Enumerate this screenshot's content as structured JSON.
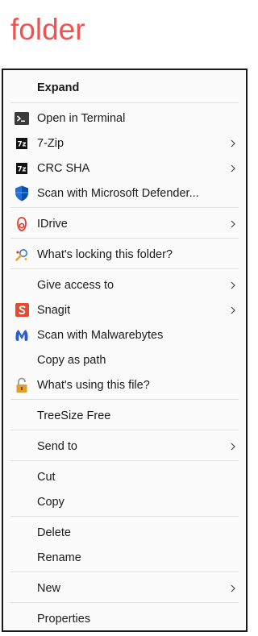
{
  "heading": "folder",
  "menu": {
    "items": [
      {
        "label": "Expand"
      },
      {
        "label": "Open in Terminal",
        "icon": "terminal-icon"
      },
      {
        "label": "7-Zip",
        "icon": "7zip-icon",
        "icon_text": "7z",
        "submenu": true
      },
      {
        "label": "CRC SHA",
        "icon": "7zip-icon",
        "icon_text": "7z",
        "submenu": true
      },
      {
        "label": "Scan with Microsoft Defender...",
        "icon": "defender-shield-icon"
      },
      {
        "label": "IDrive",
        "icon": "idrive-icon",
        "submenu": true
      },
      {
        "label": "What's locking this folder?",
        "icon": "locking-search-icon"
      },
      {
        "label": "Give access to",
        "submenu": true
      },
      {
        "label": "Snagit",
        "icon": "snagit-icon",
        "submenu": true
      },
      {
        "label": "Scan with Malwarebytes",
        "icon": "malwarebytes-icon"
      },
      {
        "label": "Copy as path"
      },
      {
        "label": "What's using this file?",
        "icon": "padlock-icon"
      },
      {
        "label": "TreeSize Free"
      },
      {
        "label": "Send to",
        "submenu": true
      },
      {
        "label": "Cut"
      },
      {
        "label": "Copy"
      },
      {
        "label": "Delete"
      },
      {
        "label": "Rename"
      },
      {
        "label": "New",
        "submenu": true
      },
      {
        "label": "Properties"
      }
    ]
  },
  "colors": {
    "heading": "#ee5352",
    "menu_bg": "#fbfbfb",
    "separator": "#e0e0e0",
    "defender_blue": "#1f6fd6",
    "snagit_orange": "#e8482f",
    "malwarebytes_blue": "#2b5fc7"
  }
}
